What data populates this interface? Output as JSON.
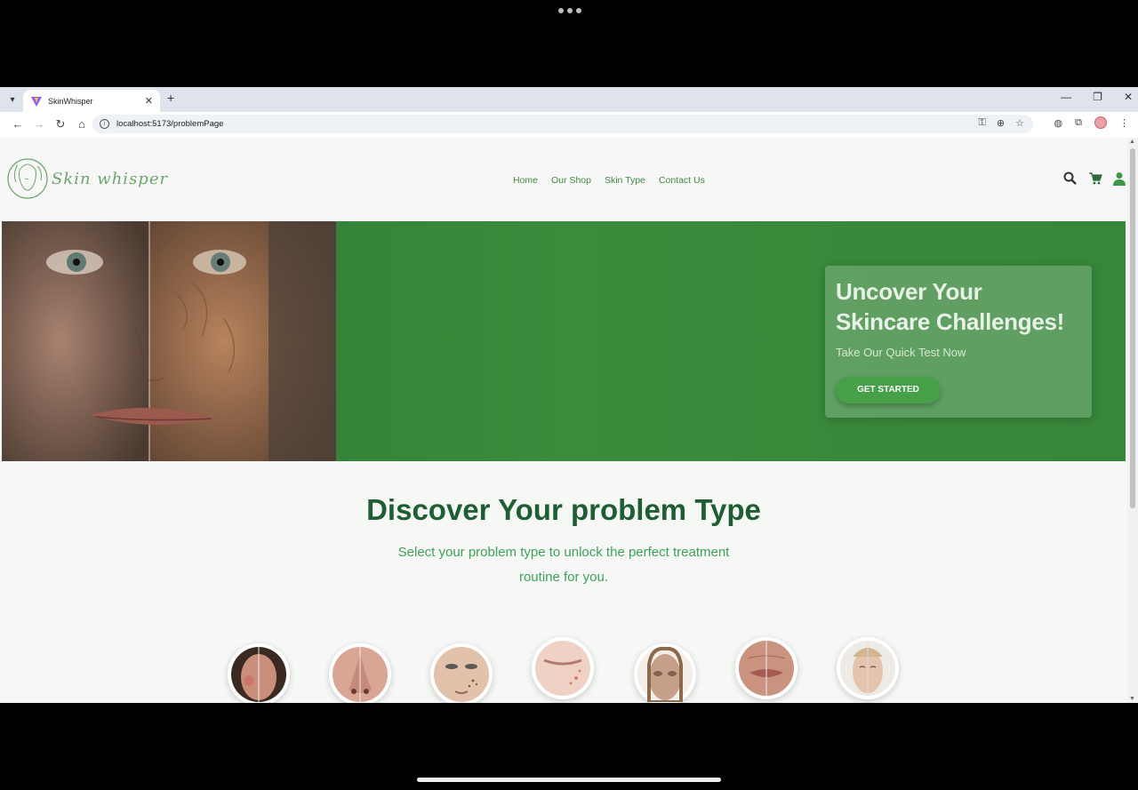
{
  "browser": {
    "tab_title": "SkinWhisper",
    "url": "localhost:5173/problemPage"
  },
  "site": {
    "logo_text": "Skin whisper",
    "nav": [
      "Home",
      "Our Shop",
      "Skin Type",
      "Contact Us"
    ]
  },
  "hero": {
    "title_line1": "Uncover Your",
    "title_line2": "Skincare Challenges!",
    "subtitle": "Take Our Quick Test Now",
    "cta": "GET STARTED"
  },
  "section": {
    "title": "Discover Your problem Type",
    "subtitle": "Select your problem type to unlock the perfect treatment routine for you."
  },
  "problem_types_count": 7,
  "colors": {
    "brand_green": "#3f8b3f",
    "hero_green": "#37863a",
    "title_green": "#1e5e33",
    "subtitle_green": "#3da15a"
  }
}
